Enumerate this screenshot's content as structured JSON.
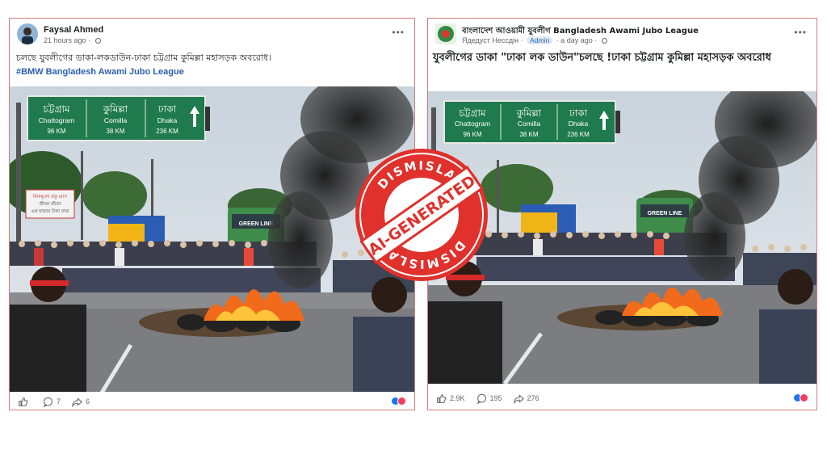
{
  "left_post": {
    "author": "Faysal Ahmed",
    "time": "21 hours ago ·",
    "caption": "চলছে যুবলীগের ডাকা-লকডাউন-ঢাকা চট্টগ্রাম কুমিল্লা মহাসড়ক অবরোধ।",
    "hashtag": "#BMW Bangladesh Awami Jubo League",
    "more": "•••",
    "likes": "",
    "comments": "7",
    "shares": "6"
  },
  "right_post": {
    "author": "বাংলাদেশ আওয়ামী যুবলীগ Bangladesh Awami Jubo League",
    "sponsor_text": "Ядедуст Нессдiн ·",
    "badge": "Admin",
    "time": "· a day ago ·",
    "caption": "যুবলীগের ডাকা \"ঢাকা লক ডাউন\"চলছে !ঢাকা চট্টগ্রাম কুমিল্লা মহাসড়ক অবরোধ",
    "more": "•••",
    "likes": "2.9K",
    "comments": "195",
    "shares": "276"
  },
  "road_sign": {
    "panels": [
      {
        "bn": "চট্টগ্রাম",
        "en": "Chattogram",
        "km": "96 KM"
      },
      {
        "bn": "কুমিল্লা",
        "en": "Comilla",
        "km": "38 KM"
      },
      {
        "bn": "ঢাকা",
        "en": "Dhaka",
        "km": "236 KM"
      }
    ],
    "billboard_lines": [
      "বিনামূল্যে চক্ষু রোগ",
      "জীবন বাঁচান",
      "এক হাজার টাকা বাজ"
    ],
    "bus_text": "GREEN LINE"
  },
  "stamp": {
    "top_text": "DISMISLAB",
    "bottom_text": "DISMISLAB",
    "center_text": "AI-GENERATED",
    "color": "#e0312c"
  },
  "colors": {
    "facebook_blue": "#1877f2",
    "sign_green": "#1f7a4d",
    "border": "#d87a7a"
  },
  "icons": [
    "like-icon",
    "comment-icon",
    "share-icon",
    "globe-icon",
    "more-icon",
    "like-reaction-icon",
    "love-reaction-icon"
  ]
}
